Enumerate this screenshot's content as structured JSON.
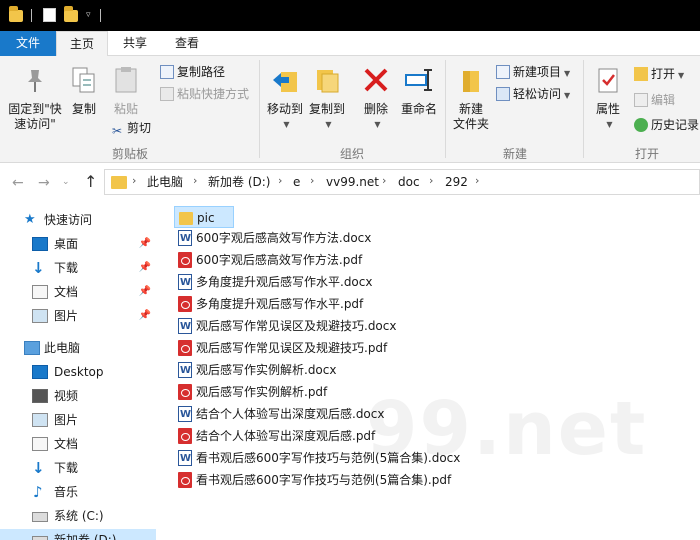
{
  "colors": {
    "accent": "#1979ca",
    "folder": "#f2c54a",
    "pdf": "#d62e2e",
    "docx": "#2b579a",
    "selection": "#cce8ff"
  },
  "tabs": {
    "file": "文件",
    "home": "主页",
    "share": "共享",
    "view": "查看"
  },
  "ribbon": {
    "clipboard": {
      "label": "剪贴板",
      "pin_line1": "固定到\"快",
      "pin_line2": "速访问\"",
      "copy": "复制",
      "paste": "粘贴",
      "copy_path": "复制路径",
      "paste_shortcut": "粘贴快捷方式",
      "cut": "剪切"
    },
    "organize": {
      "label": "组织",
      "move_to": "移动到",
      "copy_to": "复制到",
      "delete": "删除",
      "rename": "重命名"
    },
    "new": {
      "label": "新建",
      "new_folder_line1": "新建",
      "new_folder_line2": "文件夹",
      "new_item": "新建项目",
      "easy_access": "轻松访问"
    },
    "open": {
      "label": "打开",
      "properties": "属性",
      "open": "打开",
      "edit": "编辑",
      "history": "历史记录"
    }
  },
  "address": {
    "crumbs": [
      "此电脑",
      "新加卷 (D:)",
      "e",
      "vv99.net",
      "doc",
      "292"
    ]
  },
  "nav_pane": {
    "quick_access": "快速访问",
    "quick_items": [
      "桌面",
      "下载",
      "文档",
      "图片"
    ],
    "this_pc": "此电脑",
    "pc_items": [
      "Desktop",
      "视频",
      "图片",
      "文档",
      "下载",
      "音乐",
      "系统 (C:)",
      "新加卷 (D:)"
    ]
  },
  "files": [
    {
      "name": "pic",
      "type": "folder"
    },
    {
      "name": "600字观后感高效写作方法.docx",
      "type": "docx"
    },
    {
      "name": "600字观后感高效写作方法.pdf",
      "type": "pdf"
    },
    {
      "name": "多角度提升观后感写作水平.docx",
      "type": "docx"
    },
    {
      "name": "多角度提升观后感写作水平.pdf",
      "type": "pdf"
    },
    {
      "name": "观后感写作常见误区及规避技巧.docx",
      "type": "docx"
    },
    {
      "name": "观后感写作常见误区及规避技巧.pdf",
      "type": "pdf"
    },
    {
      "name": "观后感写作实例解析.docx",
      "type": "docx"
    },
    {
      "name": "观后感写作实例解析.pdf",
      "type": "pdf"
    },
    {
      "name": "结合个人体验写出深度观后感.docx",
      "type": "docx"
    },
    {
      "name": "结合个人体验写出深度观后感.pdf",
      "type": "pdf"
    },
    {
      "name": "看书观后感600字写作技巧与范例(5篇合集).docx",
      "type": "docx"
    },
    {
      "name": "看书观后感600字写作技巧与范例(5篇合集).pdf",
      "type": "pdf"
    }
  ],
  "watermark": "99.net"
}
